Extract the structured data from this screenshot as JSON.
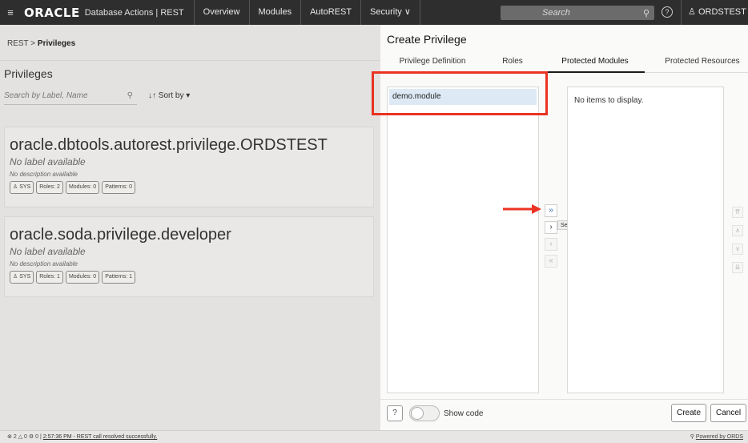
{
  "topbar": {
    "menu_glyph": "≡",
    "logo": "ORACLE",
    "app_title": "Database Actions | REST",
    "nav": [
      "Overview",
      "Modules",
      "AutoREST",
      "Security ∨"
    ],
    "search_placeholder": "Search",
    "help_glyph": "?",
    "user": "ORDSTEST"
  },
  "breadcrumb": {
    "root": "REST",
    "sep": ">",
    "current": "Privileges"
  },
  "left": {
    "page_title": "Privileges",
    "search_placeholder": "Search by Label, Name",
    "sort_label": "Sort by"
  },
  "cards": [
    {
      "title": "oracle.dbtools.autorest.privilege.ORDSTEST",
      "label": "No label available",
      "description": "No description available",
      "chips": [
        "SYS",
        "Roles: 2",
        "Modules: 0",
        "Patterns: 0"
      ]
    },
    {
      "title": "oracle.soda.privilege.developer",
      "label": "No label available",
      "description": "No description available",
      "chips": [
        "SYS",
        "Roles: 1",
        "Modules: 0",
        "Patterns: 1"
      ]
    }
  ],
  "drawer": {
    "title": "Create Privilege",
    "tabs": [
      "Privilege Definition",
      "Roles",
      "Protected Modules",
      "Protected Resources"
    ],
    "active_tab": "Protected Modules",
    "available_items": [
      "demo.module"
    ],
    "selected_empty_text": "No items to display.",
    "shuttle_tooltip": "Select all",
    "show_code_label": "Show code",
    "create_label": "Create",
    "cancel_label": "Cancel"
  },
  "status": {
    "errors": "2",
    "warnings": "0",
    "settings": "0",
    "message": "2:57:36 PM - REST call resolved successfully.",
    "powered_by": "Powered by ORDS"
  },
  "colors": {
    "annotation": "#ea3323",
    "topbar": "#2e2e2e"
  }
}
